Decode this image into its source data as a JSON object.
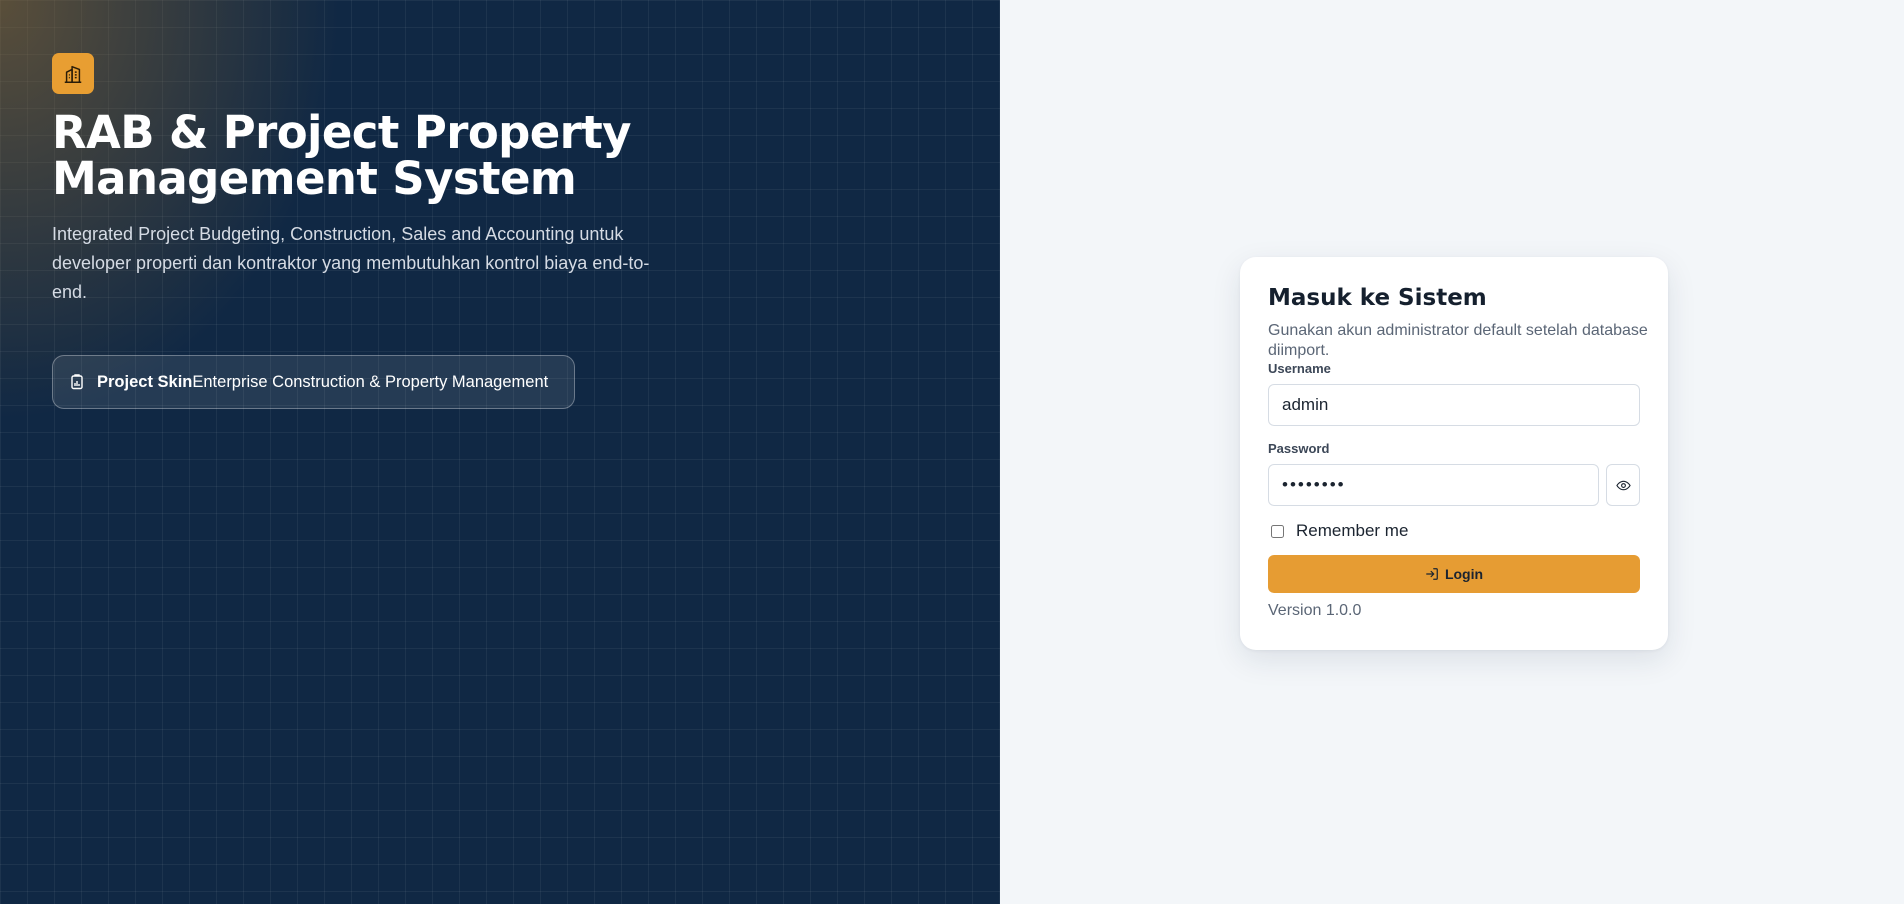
{
  "hero": {
    "logo_icon": "building-chart-icon",
    "title": "RAB & Project Property Management System",
    "description": "Integrated Project Budgeting, Construction, Sales and Accounting untuk developer properti dan kontraktor yang membutuhkan kontrol biaya end-to-end.",
    "badge": {
      "icon": "report-icon",
      "strong": "Project Skin",
      "text": "Enterprise Construction & Property Management"
    }
  },
  "login": {
    "title": "Masuk ke Sistem",
    "subtitle": "Gunakan akun administrator default setelah database diimport.",
    "username_label": "Username",
    "username_value": "admin",
    "password_label": "Password",
    "password_value": "admin123",
    "show_password_icon": "eye-icon",
    "remember_label": "Remember me",
    "remember_checked": false,
    "login_icon": "login-icon",
    "login_label": "Login",
    "version": "Version 1.0.0"
  },
  "colors": {
    "hero_bg": "#102844",
    "accent": "#e69c33",
    "page_bg": "#f3f6f9"
  }
}
